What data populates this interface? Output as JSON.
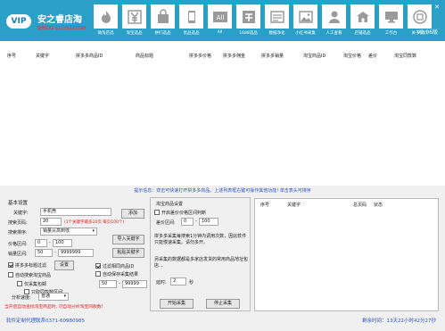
{
  "header": {
    "logo": "VIP",
    "title": "安之睿店淘",
    "contact": "客服QQ:15729222398",
    "version": "V2.06版",
    "toolbar": [
      {
        "label": "微淘店选",
        "icon": "flame-icon"
      },
      {
        "label": "淘宝选品",
        "icon": "yen-icon"
      },
      {
        "label": "拼们选品",
        "icon": "shopping-bag-icon"
      },
      {
        "label": "优品选品",
        "icon": "phone-icon"
      },
      {
        "label": "All",
        "icon": "all-icon"
      },
      {
        "label": "1688选品",
        "icon": "supply-icon"
      },
      {
        "label": "数据净化",
        "icon": "database-icon"
      },
      {
        "label": "小红书采集",
        "icon": "image-icon"
      },
      {
        "label": "人工查看",
        "icon": "person-icon"
      },
      {
        "label": "店铺选品",
        "icon": "store-icon"
      },
      {
        "label": "工作台",
        "icon": "computer-icon"
      },
      {
        "label": "关于我们",
        "icon": "dictionary-icon"
      }
    ]
  },
  "grid": {
    "columns": [
      "序号",
      "关键字",
      "拼多多商品ID",
      "商品标题",
      "拼多多价格",
      "拼多多佣金",
      "拼多多销量",
      "淘宝商品ID",
      "淘宝价格",
      "差价",
      "淘宝同款数"
    ]
  },
  "tip": "提示信息：双击可快速打开拼多多商品。上述列表框右键可操作其他功能!   单击表头可排序",
  "settings": {
    "section": "基本设置",
    "keyword_label": "关键字:",
    "keyword_value": "手机壳",
    "search_pages_label": "搜索页码:",
    "search_pages_value": "20",
    "pages_hint": "(1个关键字最多10页 每页100个)",
    "add_button": "添加",
    "sort_label": "搜索排序:",
    "sort_value": "销量从高到低",
    "price_label": "价格区间:",
    "price_min": "0",
    "price_max": "100",
    "sales_label": "销量区间:",
    "sales_min": "50",
    "sales_max": "9999999",
    "import_button": "导入关键字",
    "paste_button": "粘贴关键字",
    "filter_pdd": "拼多多标题过滤",
    "setup_button": "设置",
    "auto_search": "自动搜索淘宝商品",
    "filter_same_id": "过滤相同商品ID",
    "only_pdd": "仅采集包邮",
    "auto_save": "自动保存采集结果",
    "only_sales": "只取同款数区间",
    "count_min": "50",
    "count_max": "99999",
    "speed_label": "分析速度:",
    "speed_value": "普通",
    "warning": "当开启自动查找淘宝商品时, 可自动分析淘宝同款数!"
  },
  "taobao_settings": {
    "section": "淘宝商品设置",
    "price_diff_label": "开启差价价格区间判断",
    "diff_range_label": "差价区间:",
    "diff_min": "0",
    "diff_max": "100",
    "note1": "拼多多采集每搜索1分钟内调用次数，因此软件只能慢速采集。请勿多开。",
    "note2": "另采集的数据都是多家店发货的常用商品地址包店...",
    "delay_label": "延时:",
    "delay_value": "2",
    "delay_unit": "秒",
    "start_button": "开始采集",
    "stop_button": "停止采集"
  },
  "right_table": {
    "columns": [
      "序号",
      "关键字",
      "总页码",
      "状态"
    ]
  },
  "footer": {
    "left": "软件定制代理联系0371-60980985",
    "right": "剩余时间：13天22小时42分27秒"
  }
}
